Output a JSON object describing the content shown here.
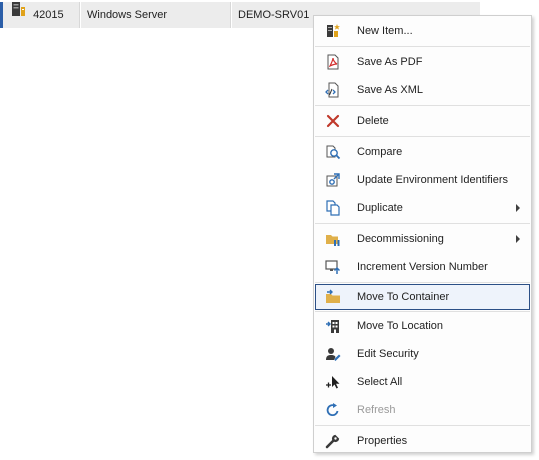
{
  "grid": {
    "row": {
      "id": "42015",
      "type": "Windows Server",
      "name": "DEMO-SRV01",
      "icon": "server-icon"
    }
  },
  "menu": {
    "items": [
      {
        "label": "New Item...",
        "icon": "new-item-icon"
      },
      {
        "label": "Save As PDF",
        "icon": "pdf-icon"
      },
      {
        "label": "Save As XML",
        "icon": "xml-icon"
      },
      {
        "label": "Delete",
        "icon": "delete-icon"
      },
      {
        "label": "Compare",
        "icon": "compare-icon"
      },
      {
        "label": "Update Environment Identifiers",
        "icon": "update-identifiers-icon"
      },
      {
        "label": "Duplicate",
        "icon": "duplicate-icon",
        "submenu": true
      },
      {
        "label": "Decommissioning",
        "icon": "decommissioning-icon",
        "submenu": true
      },
      {
        "label": "Increment Version Number",
        "icon": "increment-version-icon"
      },
      {
        "label": "Move To Container",
        "icon": "move-to-container-icon",
        "highlighted": true
      },
      {
        "label": "Move To Location",
        "icon": "move-to-location-icon"
      },
      {
        "label": "Edit Security",
        "icon": "edit-security-icon"
      },
      {
        "label": "Select All",
        "icon": "select-all-icon"
      },
      {
        "label": "Refresh",
        "icon": "refresh-icon",
        "disabled": true
      },
      {
        "label": "Properties",
        "icon": "properties-icon"
      }
    ]
  },
  "colors": {
    "highlight_border": "#2b4f86",
    "highlight_fill": "#eef3fb",
    "accent": "#2b5ea8",
    "delete_red": "#c0392b",
    "icon_blue": "#2f6fb5"
  }
}
